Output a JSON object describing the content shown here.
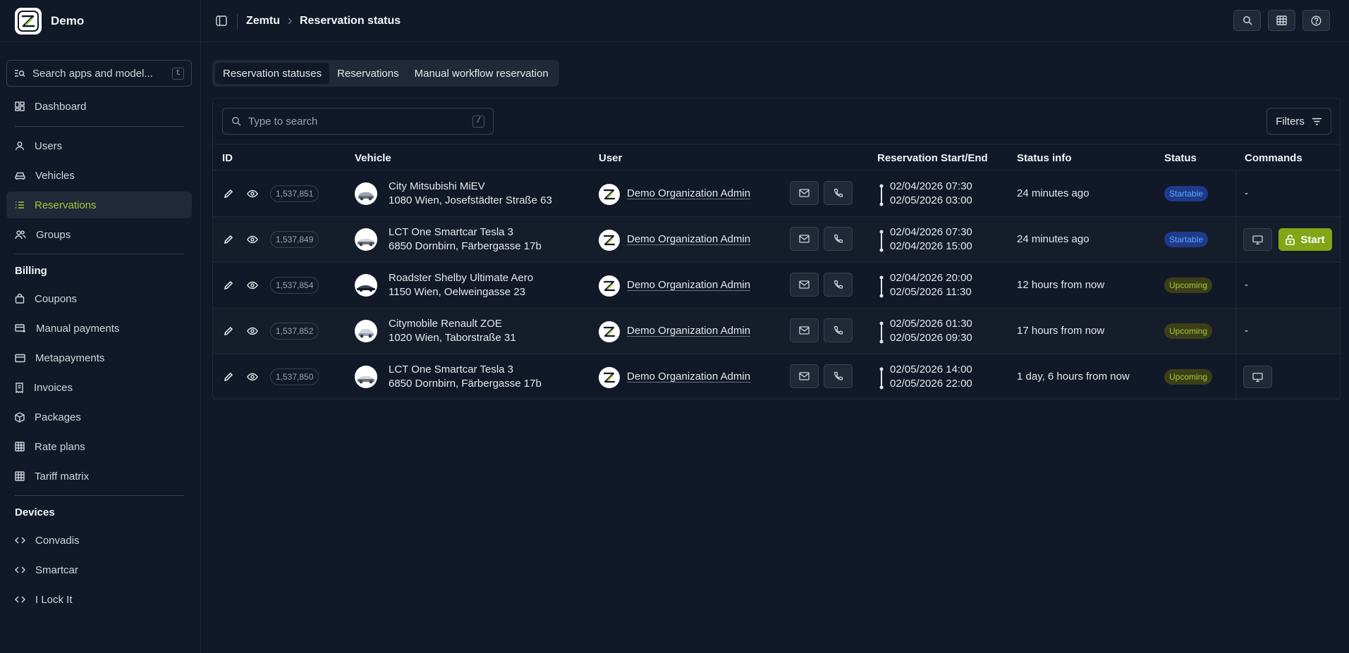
{
  "app": {
    "name": "Demo"
  },
  "breadcrumb": {
    "root": "Zemtu",
    "current": "Reservation status"
  },
  "sidebar": {
    "search": {
      "label": "Search apps and model...",
      "shortcut": "t"
    },
    "items": [
      {
        "label": "Dashboard",
        "icon": "dashboard-icon"
      },
      {
        "label": "Users",
        "icon": "user-icon"
      },
      {
        "label": "Vehicles",
        "icon": "car-icon"
      },
      {
        "label": "Reservations",
        "icon": "list-icon",
        "active": true
      },
      {
        "label": "Groups",
        "icon": "users-icon"
      }
    ],
    "billing": {
      "title": "Billing",
      "items": [
        {
          "label": "Coupons",
          "icon": "bag-icon"
        },
        {
          "label": "Manual payments",
          "icon": "card-plus-icon"
        },
        {
          "label": "Metapayments",
          "icon": "card-icon"
        },
        {
          "label": "Invoices",
          "icon": "invoice-icon"
        },
        {
          "label": "Packages",
          "icon": "package-icon"
        },
        {
          "label": "Rate plans",
          "icon": "table-icon"
        },
        {
          "label": "Tariff matrix",
          "icon": "table-icon"
        }
      ]
    },
    "devices": {
      "title": "Devices",
      "items": [
        {
          "label": "Convadis",
          "icon": "code-icon"
        },
        {
          "label": "Smartcar",
          "icon": "code-icon"
        },
        {
          "label": "I Lock It",
          "icon": "code-icon"
        }
      ]
    }
  },
  "tabs": [
    "Reservation statuses",
    "Reservations",
    "Manual workflow reservation"
  ],
  "table": {
    "search_placeholder": "Type to search",
    "search_shortcut": "/",
    "filters_label": "Filters",
    "columns": [
      "ID",
      "Vehicle",
      "User",
      "Reservation Start/End",
      "Status info",
      "Status",
      "Commands"
    ],
    "rows": [
      {
        "id": "1,537,851",
        "vehicle": "City Mitsubishi MiEV",
        "address": "1080 Wien, Josefstädter Straße 63",
        "user": "Demo Organization Admin",
        "start": "02/04/2026 07:30",
        "end": "02/05/2026 03:00",
        "info": "24 minutes ago",
        "status": "Startable",
        "command": "-"
      },
      {
        "id": "1,537,849",
        "vehicle": "LCT One Smartcar Tesla 3",
        "address": "6850 Dornbirn, Färbergasse 17b",
        "user": "Demo Organization Admin",
        "start": "02/04/2026 07:30",
        "end": "02/04/2026 15:00",
        "info": "24 minutes ago",
        "status": "Startable",
        "command": "Start"
      },
      {
        "id": "1,537,854",
        "vehicle": "Roadster Shelby Ultimate Aero",
        "address": "1150 Wien, Oelweingasse 23",
        "user": "Demo Organization Admin",
        "start": "02/04/2026 20:00",
        "end": "02/05/2026 11:30",
        "info": "12 hours from now",
        "status": "Upcoming",
        "command": "-"
      },
      {
        "id": "1,537,852",
        "vehicle": "Citymobile Renault ZOE",
        "address": "1020 Wien, Taborstraße 31",
        "user": "Demo Organization Admin",
        "start": "02/05/2026 01:30",
        "end": "02/05/2026 09:30",
        "info": "17 hours from now",
        "status": "Upcoming",
        "command": "-"
      },
      {
        "id": "1,537,850",
        "vehicle": "LCT One Smartcar Tesla 3",
        "address": "6850 Dornbirn, Färbergasse 17b",
        "user": "Demo Organization Admin",
        "start": "02/05/2026 14:00",
        "end": "02/05/2026 22:00",
        "info": "1 day, 6 hours from now",
        "status": "Upcoming",
        "command": "screen"
      }
    ]
  },
  "colors": {
    "accent": "#a3c93a",
    "start_button": "#84a516",
    "startable": "#60a5fa",
    "background": "#111827"
  }
}
